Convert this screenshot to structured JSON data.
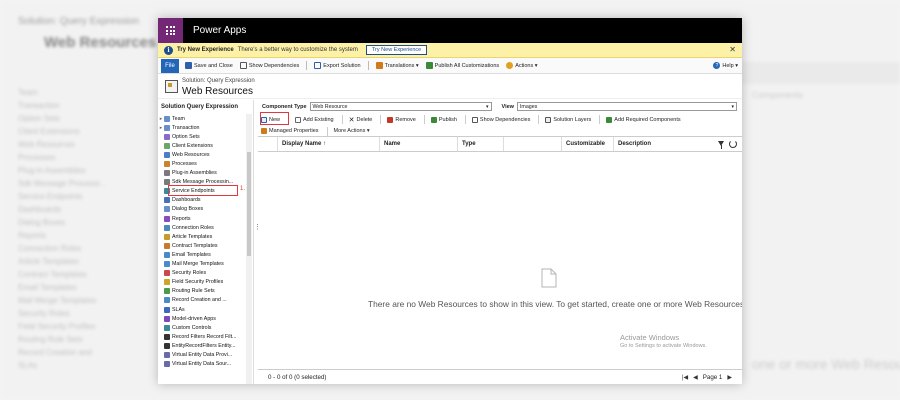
{
  "background": {
    "title": "Solution: Query Expression",
    "heading": "Web Resources",
    "list_items": [
      "Team",
      "Transaction",
      "Option Sets",
      "Client Extensions",
      "Web Resources",
      "Processes",
      "Plug-in Assemblies",
      "Sdk Message Processi...",
      "Service Endpoints",
      "Dashboards",
      "Dialog Boxes",
      "Reports",
      "Connection Roles",
      "Article Templates",
      "Contract Templates",
      "Email Templates",
      "Mail Merge Templates",
      "Security Roles",
      "Field Security Profiles",
      "Routing Rule Sets",
      "Record Creation and",
      "SLAs"
    ],
    "right_tab": "Components",
    "right_text": "one or more Web Resou"
  },
  "app": {
    "name": "Power Apps"
  },
  "notification": {
    "title": "Try New Experience",
    "text": "There's a better way to customize the system",
    "button": "Try New Experience",
    "close": "✕"
  },
  "ribbon": {
    "file": "File",
    "items": [
      "Save and Close",
      "Show Dependencies",
      "Export Solution",
      "Translations",
      "Publish All Customizations",
      "Actions"
    ],
    "help": "Help"
  },
  "solution": {
    "subtitle": "Solution: Query Expression",
    "title": "Web Resources"
  },
  "left_pane": {
    "title": "Solution Query Expression",
    "items": [
      {
        "label": "Team",
        "arrow": "▸"
      },
      {
        "label": "Transaction",
        "arrow": "▸"
      },
      {
        "label": "Option Sets",
        "arrow": ""
      },
      {
        "label": "Client Extensions",
        "arrow": ""
      },
      {
        "label": "Web Resources",
        "arrow": ""
      },
      {
        "label": "Processes",
        "arrow": ""
      },
      {
        "label": "Plug-in Assemblies",
        "arrow": ""
      },
      {
        "label": "Sdk Message Processin...",
        "arrow": ""
      },
      {
        "label": "Service Endpoints",
        "arrow": ""
      },
      {
        "label": "Dashboards",
        "arrow": ""
      },
      {
        "label": "Dialog Boxes",
        "arrow": ""
      },
      {
        "label": "Reports",
        "arrow": ""
      },
      {
        "label": "Connection Roles",
        "arrow": ""
      },
      {
        "label": "Article Templates",
        "arrow": ""
      },
      {
        "label": "Contract Templates",
        "arrow": ""
      },
      {
        "label": "Email Templates",
        "arrow": ""
      },
      {
        "label": "Mail Merge Templates",
        "arrow": ""
      },
      {
        "label": "Security Roles",
        "arrow": ""
      },
      {
        "label": "Field Security Profiles",
        "arrow": ""
      },
      {
        "label": "Routing Rule Sets",
        "arrow": ""
      },
      {
        "label": "Record Creation and ...",
        "arrow": ""
      },
      {
        "label": "SLAs",
        "arrow": ""
      },
      {
        "label": "Model-driven Apps",
        "arrow": ""
      },
      {
        "label": "Custom Controls",
        "arrow": ""
      },
      {
        "label": "Record Filters Record Filt...",
        "arrow": ""
      },
      {
        "label": "EntityRecordFilters Entity...",
        "arrow": ""
      },
      {
        "label": "Virtual Entity Data Provi...",
        "arrow": ""
      },
      {
        "label": "Virtual Entity Data Sour...",
        "arrow": ""
      }
    ],
    "annotation": "1."
  },
  "filters": {
    "component_type_label": "Component Type",
    "component_type_value": "Web Resource",
    "view_label": "View",
    "view_value": "Images"
  },
  "toolbar": {
    "new": "New",
    "add_existing": "Add Existing",
    "delete": "Delete",
    "remove": "Remove",
    "publish": "Publish",
    "show_dependencies": "Show Dependencies",
    "solution_layers": "Solution Layers",
    "add_required": "Add Required Components",
    "managed_properties": "Managed Properties",
    "more_actions": "More Actions"
  },
  "grid": {
    "columns": [
      "Display Name ↑",
      "Name",
      "Type",
      "Customizable",
      "Description"
    ],
    "empty_message": "There are no Web Resources to show in this view. To get started, create one or more Web Resources."
  },
  "watermark": {
    "line1": "Activate Windows",
    "line2": "Go to Settings to activate Windows."
  },
  "footer": {
    "status": "0 - 0 of 0 (0 selected)",
    "page": "Page 1"
  },
  "colors": {
    "accent": "#742774",
    "highlight": "#e0383e",
    "file_tab": "#2266b8"
  }
}
